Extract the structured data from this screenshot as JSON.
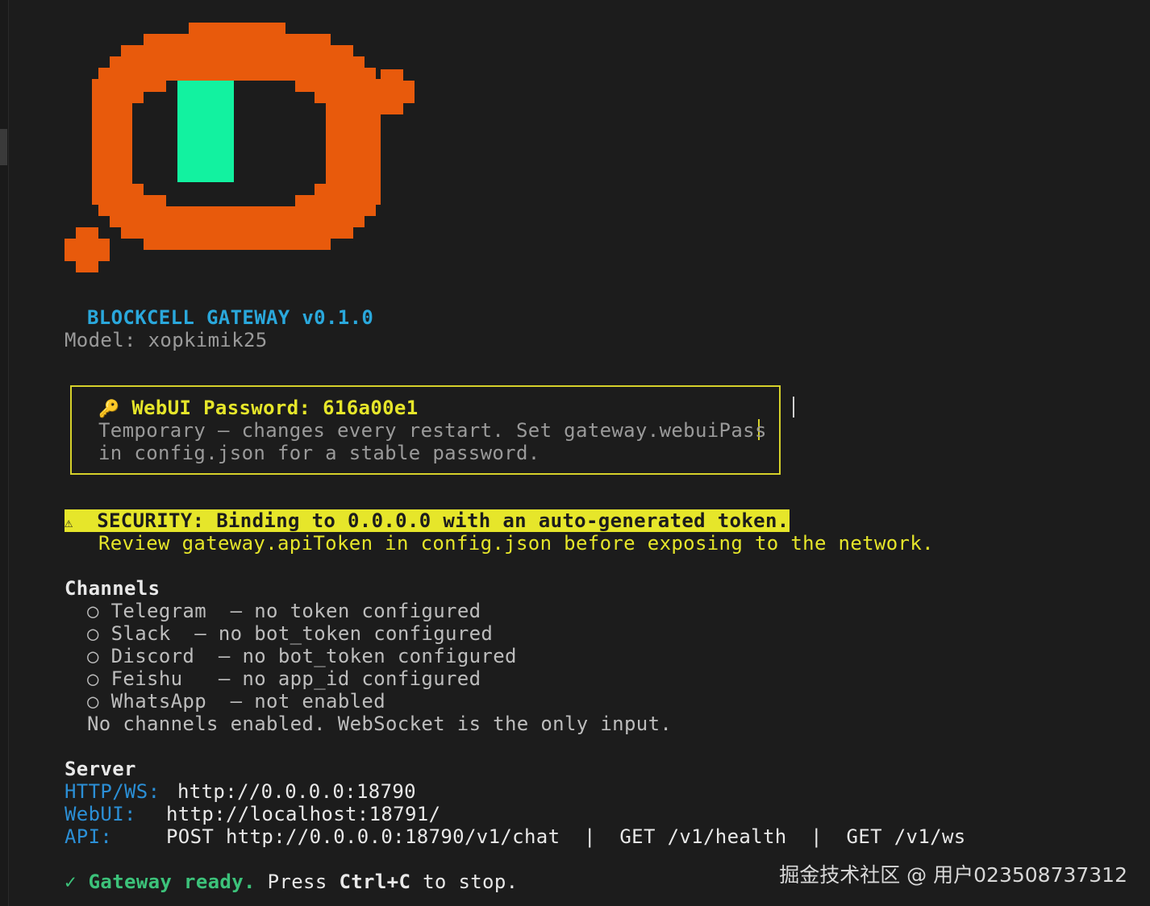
{
  "colors": {
    "background": "#1c1c1c",
    "logo_orange": "#e85a0c",
    "logo_green": "#12f2a0",
    "accent_cyan": "#2aa8dc",
    "warning_yellow": "#e6e62a",
    "success_green": "#3cc27a",
    "label_blue": "#2b8fd6"
  },
  "banner": {
    "title": "BLOCKCELL GATEWAY v0.1.0",
    "model": "Model: xopkimik25"
  },
  "password_box": {
    "icon": "key-icon",
    "icon_glyph": "🔑",
    "label": "WebUI Password:",
    "value": "616a00e1",
    "line1": "Temporary — changes every restart. Set gateway.webuiPass",
    "line2": "in config.json for a stable password."
  },
  "security": {
    "icon": "warning-icon",
    "icon_glyph": "⚠",
    "headline": "SECURITY: Binding to 0.0.0.0 with an auto-generated token.",
    "detail": "Review gateway.apiToken in config.json before exposing to the network."
  },
  "channels": {
    "heading": "Channels",
    "bullet": "○",
    "items": [
      {
        "name": "Telegram",
        "status": "— no token configured"
      },
      {
        "name": "Slack",
        "status": "— no bot_token configured"
      },
      {
        "name": "Discord",
        "status": "— no bot_token configured"
      },
      {
        "name": "Feishu",
        "status": "— no app_id configured"
      },
      {
        "name": "WhatsApp",
        "status": "— not enabled"
      }
    ],
    "summary": "No channels enabled. WebSocket is the only input."
  },
  "server": {
    "heading": "Server",
    "http_label": "HTTP/WS:",
    "http_value": "http://0.0.0.0:18790",
    "webui_label": "WebUI:",
    "webui_value": "http://localhost:18791/",
    "api_label": "API:",
    "api_value": "POST http://0.0.0.0:18790/v1/chat  |  GET /v1/health  |  GET /v1/ws"
  },
  "footer": {
    "check": "✓",
    "ready": "Gateway ready.",
    "press": "Press",
    "keys": "Ctrl+C",
    "stop": "to stop."
  },
  "watermark": "掘金技术社区 @ 用户023508737312"
}
